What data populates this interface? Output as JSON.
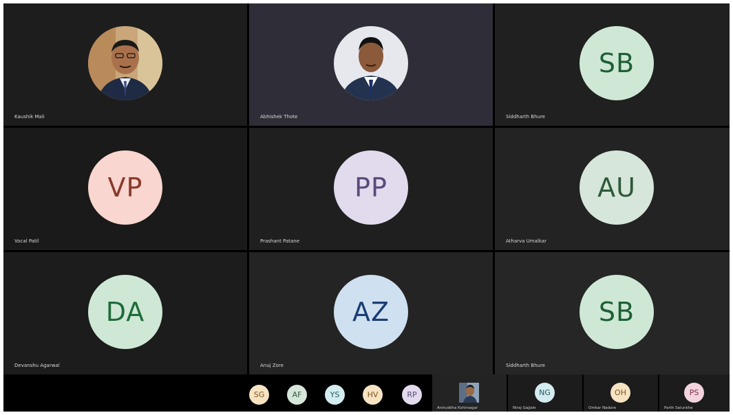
{
  "colors": {
    "background": "#000000",
    "tile_dark": "#1b1b1b",
    "tile_active": "#2e2d37",
    "tile_mid": "#232323",
    "name_text": "#d8d8d8"
  },
  "participants": [
    {
      "name": "Kaushik Mali",
      "avatar": "photo",
      "bg": "#1d1d1d"
    },
    {
      "name": "Abhishek Thote",
      "avatar": "photo",
      "bg": "#2f2e38"
    },
    {
      "name": "Siddharth Bhure",
      "initials": "SB",
      "bg": "#202020",
      "avatar_bg": "#cfe8d6",
      "avatar_fg": "#1f5f36"
    },
    {
      "name": "Vocal Patil",
      "initials": "VP",
      "bg": "#1a1a1a",
      "avatar_bg": "#f9d6cf",
      "avatar_fg": "#8a3a2c"
    },
    {
      "name": "Prashant Patane",
      "initials": "PP",
      "bg": "#1f1f1f",
      "avatar_bg": "#e2dbee",
      "avatar_fg": "#5a4a7a"
    },
    {
      "name": "Atharva Umalkar",
      "initials": "AU",
      "bg": "#232323",
      "avatar_bg": "#d7e6da",
      "avatar_fg": "#2d5a3a"
    },
    {
      "name": "Devanshu Agarwal",
      "initials": "DA",
      "bg": "#1c1c1c",
      "avatar_bg": "#cfe8d6",
      "avatar_fg": "#1f6b3a"
    },
    {
      "name": "Anuj Zore",
      "initials": "AZ",
      "bg": "#242424",
      "avatar_bg": "#cfe0f0",
      "avatar_fg": "#1a3e74"
    },
    {
      "name": "Siddharth Bhure",
      "initials": "SB",
      "bg": "#262626",
      "avatar_bg": "#cfe8d6",
      "avatar_fg": "#1f5f36"
    }
  ],
  "overflow_avatars": [
    {
      "initials": "SG",
      "avatar_bg": "#f7e3c2",
      "avatar_fg": "#7a5522"
    },
    {
      "initials": "AF",
      "avatar_bg": "#d7e6da",
      "avatar_fg": "#2d5a3a"
    },
    {
      "initials": "YS",
      "avatar_bg": "#d4ecef",
      "avatar_fg": "#1f5a62"
    },
    {
      "initials": "HV",
      "avatar_bg": "#f7e3c2",
      "avatar_fg": "#7a5522"
    },
    {
      "initials": "RP",
      "avatar_bg": "#e2dbee",
      "avatar_fg": "#5a4a7a"
    }
  ],
  "strip_tiles": [
    {
      "name": "Aniruddha Kshirsagar",
      "avatar": "photo",
      "bg": "#232323"
    },
    {
      "name": "Niraj Gajjale",
      "initials": "NG",
      "bg": "#1c1c1c",
      "avatar_bg": "#d4ecef",
      "avatar_fg": "#1f5a62"
    },
    {
      "name": "Omkar Nadare",
      "initials": "OH",
      "bg": "#1c1c1c",
      "avatar_bg": "#f7e3c2",
      "avatar_fg": "#7a5522"
    },
    {
      "name": "Parth Salunkhe",
      "initials": "PS",
      "bg": "#1c1c1c",
      "avatar_bg": "#f3d4de",
      "avatar_fg": "#7a2a4a"
    }
  ]
}
